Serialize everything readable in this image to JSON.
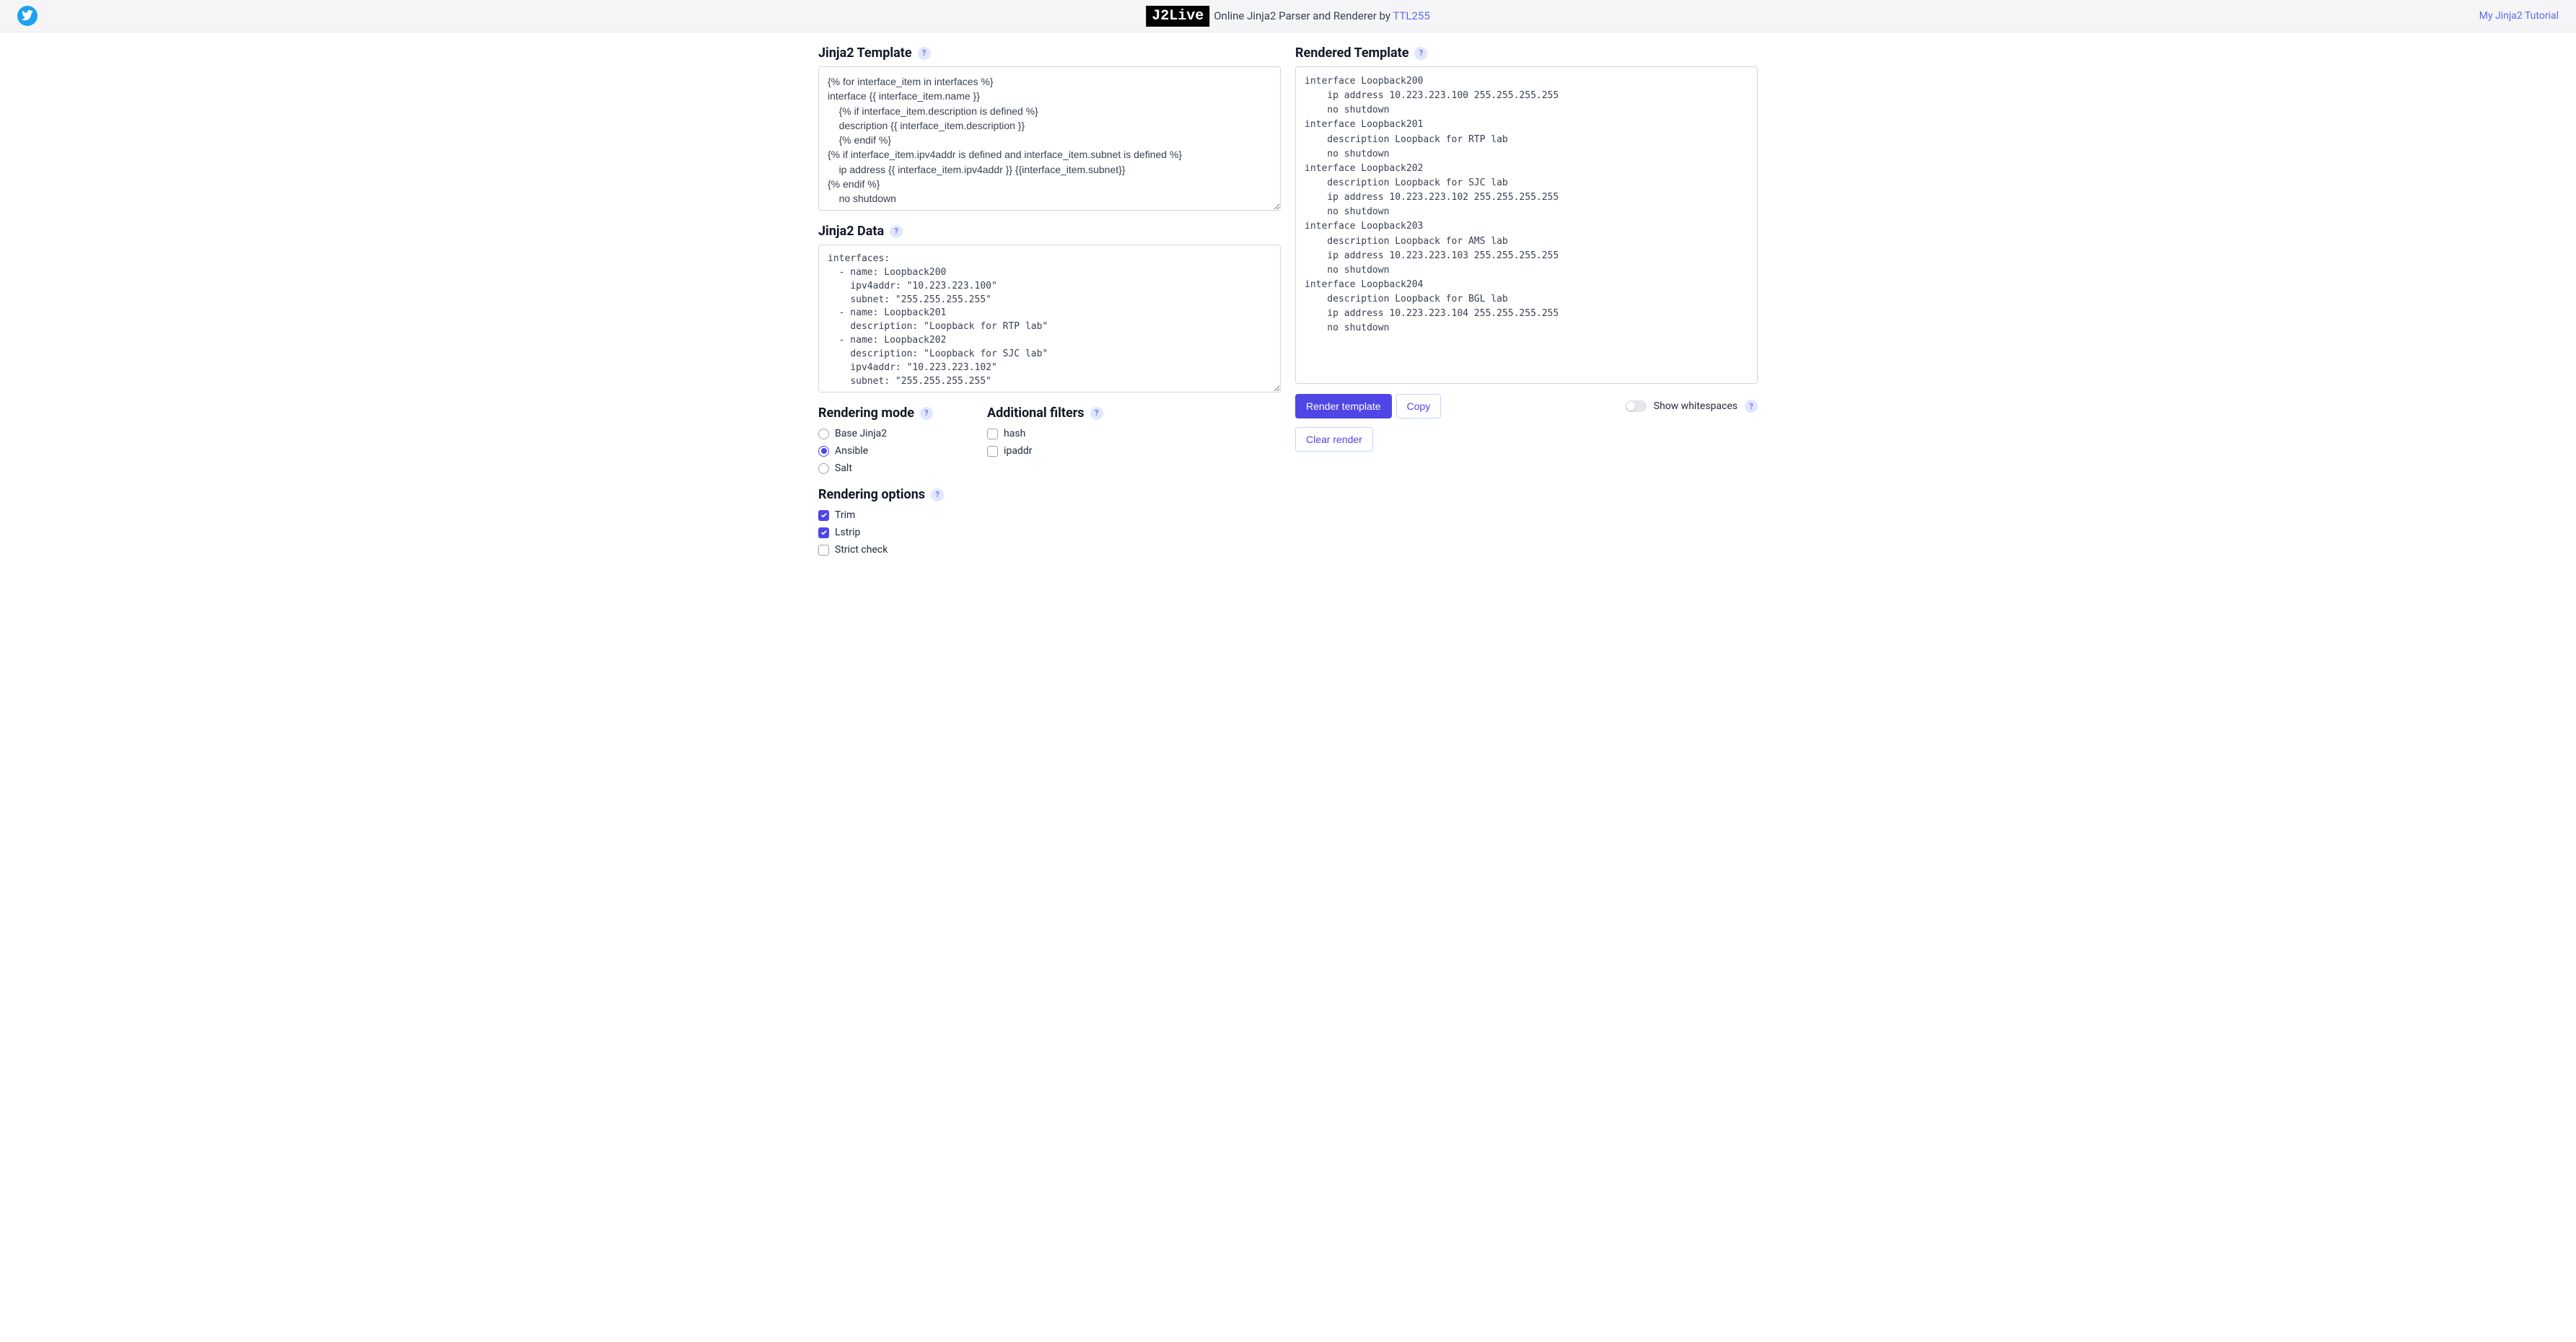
{
  "header": {
    "logo_text": "J2Live",
    "tagline_prefix": "Online Jinja2 Parser and Renderer by ",
    "tagline_link": "TTL255",
    "tutorial_link": "My Jinja2 Tutorial"
  },
  "left": {
    "template_title": "Jinja2 Template",
    "template_value": "{% for interface_item in interfaces %}\ninterface {{ interface_item.name }}\n    {% if interface_item.description is defined %}\n    description {{ interface_item.description }}\n    {% endif %}\n{% if interface_item.ipv4addr is defined and interface_item.subnet is defined %}\n    ip address {{ interface_item.ipv4addr }} {{interface_item.subnet}}\n{% endif %}\n    no shutdown\n{% endfor %}",
    "data_title": "Jinja2 Data",
    "data_value": "interfaces:\n  - name: Loopback200\n    ipv4addr: \"10.223.223.100\"\n    subnet: \"255.255.255.255\"\n  - name: Loopback201\n    description: \"Loopback for RTP lab\"\n  - name: Loopback202\n    description: \"Loopback for SJC lab\"\n    ipv4addr: \"10.223.223.102\"\n    subnet: \"255.255.255.255\"",
    "rendering_mode_title": "Rendering mode",
    "rendering_modes": {
      "base": "Base Jinja2",
      "ansible": "Ansible",
      "salt": "Salt"
    },
    "rendering_options_title": "Rendering options",
    "rendering_options": {
      "trim": "Trim",
      "lstrip": "Lstrip",
      "strict": "Strict check"
    },
    "filters_title": "Additional filters",
    "filters": {
      "hash": "hash",
      "ipaddr": "ipaddr"
    }
  },
  "right": {
    "output_title": "Rendered Template",
    "output_value": "interface Loopback200\n    ip address 10.223.223.100 255.255.255.255\n    no shutdown\ninterface Loopback201\n    description Loopback for RTP lab\n    no shutdown\ninterface Loopback202\n    description Loopback for SJC lab\n    ip address 10.223.223.102 255.255.255.255\n    no shutdown\ninterface Loopback203\n    description Loopback for AMS lab\n    ip address 10.223.223.103 255.255.255.255\n    no shutdown\ninterface Loopback204\n    description Loopback for BGL lab\n    ip address 10.223.223.104 255.255.255.255\n    no shutdown",
    "buttons": {
      "render": "Render template",
      "copy": "Copy",
      "clear": "Clear render"
    },
    "show_whitespace_label": "Show whitespaces"
  }
}
